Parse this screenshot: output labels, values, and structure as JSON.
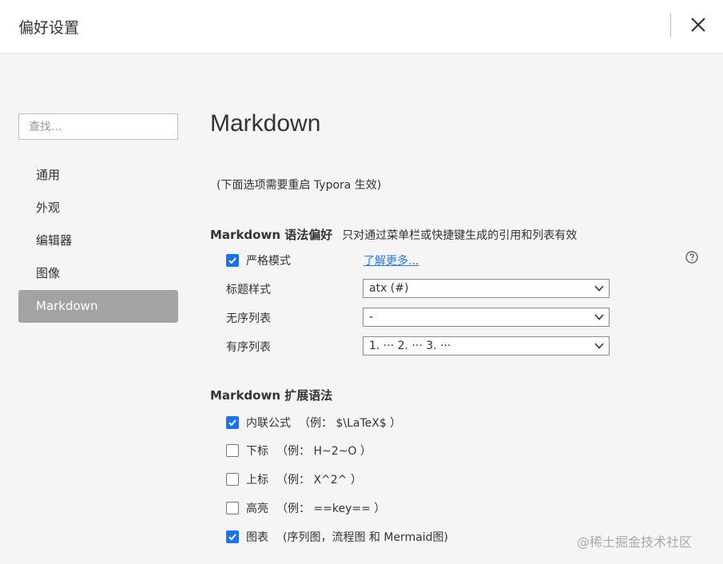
{
  "window": {
    "title": "偏好设置"
  },
  "search": {
    "placeholder": "查找..."
  },
  "sidebar": {
    "items": [
      {
        "label": "通用"
      },
      {
        "label": "外观"
      },
      {
        "label": "编辑器"
      },
      {
        "label": "图像"
      },
      {
        "label": "Markdown",
        "active": true
      }
    ]
  },
  "main": {
    "title": "Markdown",
    "restart_note": "(下面选项需要重启 Typora 生效)",
    "syntax_pref": {
      "heading": "Markdown 语法偏好",
      "subheading": "只对通过菜单栏或快捷键生成的引用和列表有效",
      "strict_mode_label": "严格模式",
      "strict_mode_checked": true,
      "learn_more": "了解更多...",
      "heading_style_label": "标题样式",
      "heading_style_value": "atx (#)",
      "unordered_list_label": "无序列表",
      "unordered_list_value": "-",
      "ordered_list_label": "有序列表",
      "ordered_list_value": "1. ··· 2. ··· 3. ···"
    },
    "extended": {
      "heading": "Markdown 扩展语法",
      "items": [
        {
          "label": "内联公式",
          "example": "（例： $\\LaTeX$ ）",
          "checked": true
        },
        {
          "label": "下标",
          "example": "（例： H~2~O ）",
          "checked": false
        },
        {
          "label": "上标",
          "example": "（例： X^2^ ）",
          "checked": false
        },
        {
          "label": "高亮",
          "example": "（例： ==key== ）",
          "checked": false
        },
        {
          "label": "图表",
          "example": "(序列图，流程图 和 Mermaid图)",
          "checked": true
        }
      ]
    }
  },
  "watermark": "@稀土掘金技术社区",
  "colors": {
    "accent": "#1a73e8",
    "link": "#2a7ad8",
    "active_nav": "#a3a3a3"
  }
}
